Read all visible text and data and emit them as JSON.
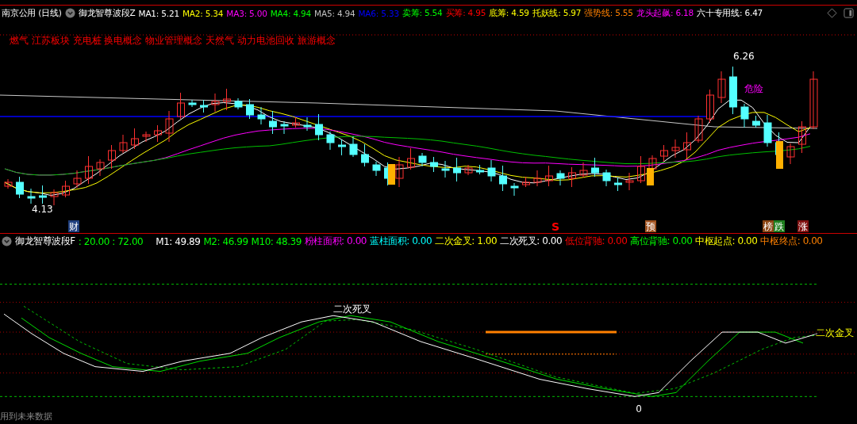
{
  "header": {
    "stock": "南京公用 (日线)",
    "indicator": "御龙智尊波段Z",
    "items": [
      {
        "text": "MA1: 5.21",
        "color": "#ffffff"
      },
      {
        "text": "MA2: 5.34",
        "color": "#ffff00"
      },
      {
        "text": "MA3: 5.00",
        "color": "#ff00ff"
      },
      {
        "text": "MA4: 4.94",
        "color": "#00ff00"
      },
      {
        "text": "MA5: 4.94",
        "color": "#c0c0c0"
      },
      {
        "text": "MA6: 5.33",
        "color": "#0000ff"
      },
      {
        "text": "卖筹: 5.54",
        "color": "#00ff00"
      },
      {
        "text": "买筹: 4.95",
        "color": "#ff0000"
      },
      {
        "text": "底筹: 4.59",
        "color": "#ffff00"
      },
      {
        "text": "托妖线: 5.97",
        "color": "#ffff00"
      },
      {
        "text": "强势线: 5.55",
        "color": "#ff8000"
      },
      {
        "text": "龙头起飙: 6.18",
        "color": "#ff00ff"
      },
      {
        "text": "六十专用线: 6.47",
        "color": "#ffffff"
      }
    ]
  },
  "concepts": "燃气 江苏板块 充电桩 换电概念 物业管理概念 天然气 动力电池回收 旅游概念",
  "upper_annotations": [
    {
      "kind": "high",
      "text": "6.26"
    },
    {
      "kind": "low",
      "text": "4.13"
    },
    {
      "kind": "warning",
      "text": "危险"
    }
  ],
  "markers": [
    {
      "kind": "tag",
      "text": "财",
      "color": "#1f3f7f"
    },
    {
      "kind": "letter",
      "text": "S",
      "color": "#ff0000"
    },
    {
      "kind": "tag",
      "text": "预",
      "color": "#a0521f"
    },
    {
      "kind": "tag",
      "text": "榜",
      "color": "#8b4513"
    },
    {
      "kind": "tag",
      "text": "跌",
      "color": "#1f7f1f"
    },
    {
      "kind": "tag",
      "text": "涨",
      "color": "#7f1010"
    }
  ],
  "lower_header": {
    "indicator": "御龙智尊波段F",
    "params": ": 20.00 : 72.00",
    "items": [
      {
        "text": "M1: 49.89",
        "color": "#ffffff"
      },
      {
        "text": "M2: 46.99",
        "color": "#00ff00"
      },
      {
        "text": "M10: 48.39",
        "color": "#00ff00"
      },
      {
        "text": "粉柱面积: 0.00",
        "color": "#ff00ff"
      },
      {
        "text": "蓝柱面积: 0.00",
        "color": "#00ffff"
      },
      {
        "text": "二次金叉: 1.00",
        "color": "#ffff00"
      },
      {
        "text": "二次死叉: 0.00",
        "color": "#ffffff"
      },
      {
        "text": "低位背驰: 0.00",
        "color": "#ff0000"
      },
      {
        "text": "高位背驰: 0.00",
        "color": "#00ff00"
      },
      {
        "text": "中枢起点: 0.00",
        "color": "#ffff00"
      },
      {
        "text": "中枢终点: 0.00",
        "color": "#ff8000"
      }
    ]
  },
  "lower_annotations": [
    {
      "kind": "death_cross",
      "text": "二次死叉"
    },
    {
      "kind": "golden_cross",
      "text": "二次金叉"
    },
    {
      "kind": "zero",
      "text": "0"
    }
  ],
  "footer_note": "用到未来数据"
}
